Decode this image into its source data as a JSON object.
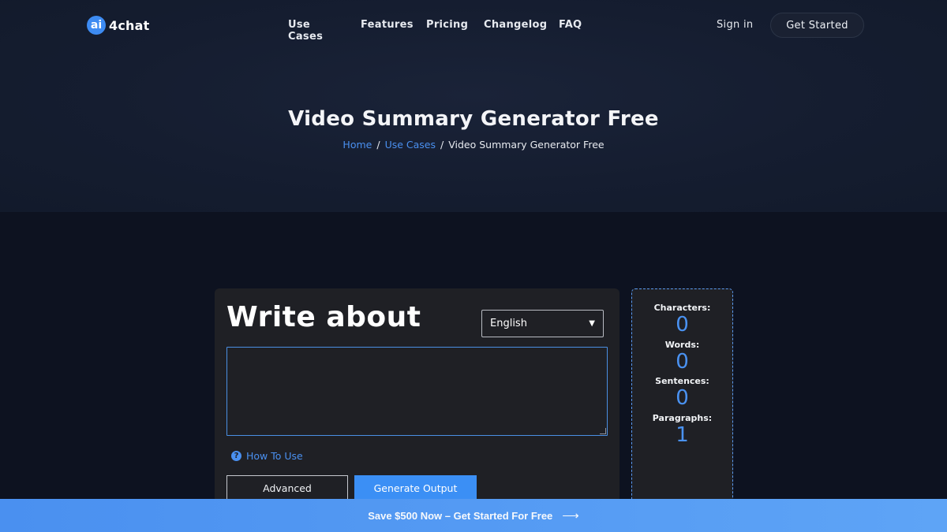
{
  "brand": {
    "badge": "ai",
    "name": "4chat"
  },
  "nav": {
    "links": [
      "Use Cases",
      "Features",
      "Pricing",
      "Changelog",
      "FAQ"
    ],
    "sign_in": "Sign in",
    "get_started": "Get Started"
  },
  "hero": {
    "title": "Video Summary Generator Free",
    "breadcrumb": [
      "Home",
      "Use Cases",
      "Video Summary Generator Free"
    ],
    "separator": "/"
  },
  "editor": {
    "heading": "Write about",
    "language": "English",
    "textarea_value": "",
    "how_to_use": "How To Use",
    "advanced_label": "Advanced",
    "generate_label": "Generate Output"
  },
  "stats": [
    {
      "label": "Characters:",
      "value": "0"
    },
    {
      "label": "Words:",
      "value": "0"
    },
    {
      "label": "Sentences:",
      "value": "0"
    },
    {
      "label": "Paragraphs:",
      "value": "1"
    }
  ],
  "promo": {
    "text": "Save $500 Now – Get Started For Free",
    "arrow": "⟶"
  },
  "colors": {
    "accent": "#3b8ff5",
    "background": "#0d1220",
    "card": "#1f2025"
  }
}
